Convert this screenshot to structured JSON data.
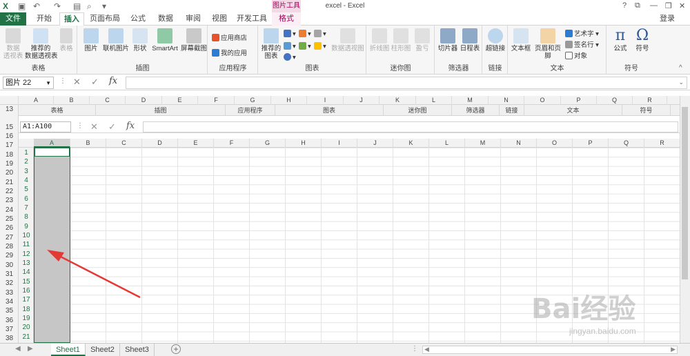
{
  "titlebar": {
    "title": "excel - Excel",
    "context_group": "图片工具"
  },
  "tabs": [
    "文件",
    "开始",
    "插入",
    "页面布局",
    "公式",
    "数据",
    "审阅",
    "视图",
    "开发工具",
    "格式"
  ],
  "login": "登录",
  "ribbon": {
    "table_group": {
      "label": "表格",
      "buttons": [
        "数据\n透视表",
        "推荐的\n数据透视表",
        "表格"
      ]
    },
    "illus_group": {
      "label": "插图",
      "buttons": [
        "图片",
        "联机图片",
        "形状",
        "SmartArt",
        "屏幕截图"
      ]
    },
    "apps_group": {
      "label": "应用程序",
      "items": [
        "应用商店",
        "我的应用"
      ]
    },
    "charts_group": {
      "label": "图表",
      "buttons": [
        "推荐的\n图表",
        "数据透视图"
      ]
    },
    "spark_group": {
      "label": "迷你图",
      "buttons": [
        "折线图",
        "柱形图",
        "盈亏"
      ]
    },
    "filter_group": {
      "label": "筛选器",
      "buttons": [
        "切片器",
        "日程表"
      ]
    },
    "links_group": {
      "label": "链接",
      "buttons": [
        "超链接"
      ]
    },
    "text_group": {
      "label": "文本",
      "buttons": [
        "文本框",
        "页眉和页脚"
      ],
      "items": [
        "艺术字",
        "签名行",
        "对象"
      ]
    },
    "symbols_group": {
      "label": "符号",
      "buttons": [
        "公式",
        "符号"
      ]
    }
  },
  "formula_bar_outer": {
    "name_box": "图片 22",
    "fx": "fx"
  },
  "outer_columns": [
    "A",
    "B",
    "C",
    "D",
    "E",
    "F",
    "G",
    "H",
    "I",
    "J",
    "K",
    "L",
    "M",
    "N",
    "O",
    "P",
    "Q",
    "R"
  ],
  "outer_rows": [
    "13",
    "15",
    "16",
    "17",
    "18",
    "19",
    "20",
    "21",
    "22",
    "23",
    "24",
    "25",
    "26",
    "27",
    "28",
    "29",
    "30",
    "31",
    "32",
    "33",
    "34",
    "35",
    "36",
    "37",
    "38"
  ],
  "embedded": {
    "group_labels": [
      "表格",
      "插图",
      "应用程序",
      "图表",
      "迷你图",
      "筛选器",
      "链接",
      "文本",
      "符号"
    ],
    "name_box": "A1:A100",
    "fx": "fx",
    "columns": [
      "A",
      "B",
      "C",
      "D",
      "E",
      "F",
      "G",
      "H",
      "I",
      "J",
      "K",
      "L",
      "M",
      "N",
      "O",
      "P",
      "Q",
      "R"
    ],
    "rows": [
      "1",
      "2",
      "3",
      "4",
      "5",
      "6",
      "7",
      "8",
      "9",
      "10",
      "11",
      "12",
      "13",
      "14",
      "15",
      "16",
      "17",
      "18",
      "19",
      "20",
      "21"
    ]
  },
  "sheets": [
    "Sheet1",
    "Sheet2",
    "Sheet3"
  ],
  "watermark": {
    "brand": "Bai经验",
    "url": "jingyan.baidu.com"
  },
  "colors": {
    "excel_green": "#217346",
    "arrow_red": "#e53935",
    "context_pink": "#a4005a"
  }
}
